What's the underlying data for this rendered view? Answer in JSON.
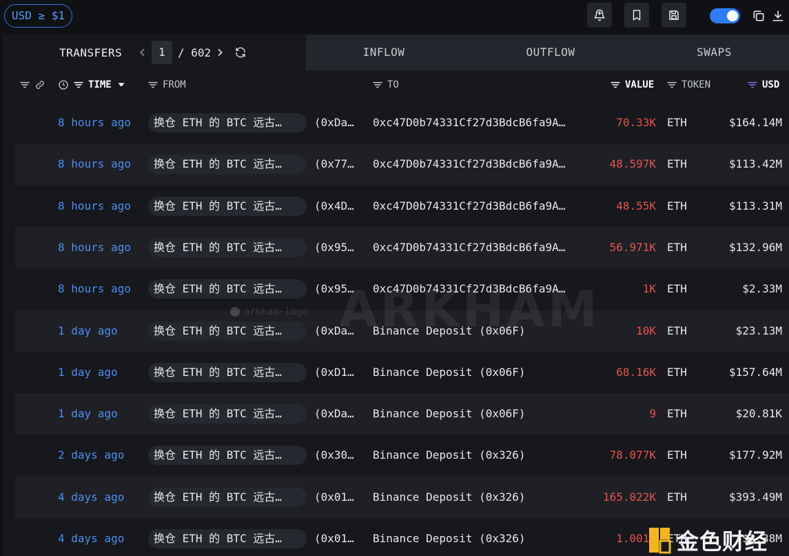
{
  "topbar": {
    "filter_pill": "USD ≥ $1"
  },
  "tabs": {
    "main_label": "TRANSFERS",
    "current_page": "1",
    "total_pages": "/ 602",
    "others": [
      "INFLOW",
      "OUTFLOW",
      "SWAPS"
    ]
  },
  "header": {
    "time": "TIME",
    "from": "FROM",
    "to": "TO",
    "value": "VALUE",
    "token": "TOKEN",
    "usd": "USD"
  },
  "rows": [
    {
      "time": "8 hours ago",
      "from": "换仓 ETH 的 BTC 远古…",
      "from_addr": "(0xDa…",
      "to": "0xc47D0b74331Cf27d3BdcB6fa9A…",
      "value": "70.33K",
      "token": "ETH",
      "usd": "$164.14M"
    },
    {
      "time": "8 hours ago",
      "from": "换仓 ETH 的 BTC 远古…",
      "from_addr": "(0x77…",
      "to": "0xc47D0b74331Cf27d3BdcB6fa9A…",
      "value": "48.597K",
      "token": "ETH",
      "usd": "$113.42M"
    },
    {
      "time": "8 hours ago",
      "from": "换仓 ETH 的 BTC 远古…",
      "from_addr": "(0x4D…",
      "to": "0xc47D0b74331Cf27d3BdcB6fa9A…",
      "value": "48.55K",
      "token": "ETH",
      "usd": "$113.31M"
    },
    {
      "time": "8 hours ago",
      "from": "换仓 ETH 的 BTC 远古…",
      "from_addr": "(0x95…",
      "to": "0xc47D0b74331Cf27d3BdcB6fa9A…",
      "value": "56.971K",
      "token": "ETH",
      "usd": "$132.96M"
    },
    {
      "time": "8 hours ago",
      "from": "换仓 ETH 的 BTC 远古…",
      "from_addr": "(0x95…",
      "to": "0xc47D0b74331Cf27d3BdcB6fa9A…",
      "value": "1K",
      "token": "ETH",
      "usd": "$2.33M"
    },
    {
      "time": "1 day ago",
      "from": "换仓 ETH 的 BTC 远古…",
      "from_addr": "(0xDa…",
      "to": "Binance Deposit (0x06F)",
      "value": "10K",
      "token": "ETH",
      "usd": "$23.13M"
    },
    {
      "time": "1 day ago",
      "from": "换仓 ETH 的 BTC 远古…",
      "from_addr": "(0xD1…",
      "to": "Binance Deposit (0x06F)",
      "value": "68.16K",
      "token": "ETH",
      "usd": "$157.64M"
    },
    {
      "time": "1 day ago",
      "from": "换仓 ETH 的 BTC 远古…",
      "from_addr": "(0xDa…",
      "to": "Binance Deposit (0x06F)",
      "value": "9",
      "token": "ETH",
      "usd": "$20.81K"
    },
    {
      "time": "2 days ago",
      "from": "换仓 ETH 的 BTC 远古…",
      "from_addr": "(0x30…",
      "to": "Binance Deposit (0x326)",
      "value": "78.077K",
      "token": "ETH",
      "usd": "$177.92M"
    },
    {
      "time": "4 days ago",
      "from": "换仓 ETH 的 BTC 远古…",
      "from_addr": "(0x01…",
      "to": "Binance Deposit (0x326)",
      "value": "165.022K",
      "token": "ETH",
      "usd": "$393.49M"
    },
    {
      "time": "4 days ago",
      "from": "换仓 ETH 的 BTC 远古…",
      "from_addr": "(0x01…",
      "to": "Binance Deposit (0x326)",
      "value": "1.001K",
      "token": "ETH",
      "usd": "$2.38M"
    }
  ],
  "watermark": {
    "text": "ARKHAM",
    "logo_alt": "arkham-logo"
  },
  "corner_logo": {
    "text": "金色财经"
  },
  "colors": {
    "accent_blue": "#4d8ef0",
    "value_red": "#e8534c",
    "toggle_on": "#2f7cf6"
  }
}
